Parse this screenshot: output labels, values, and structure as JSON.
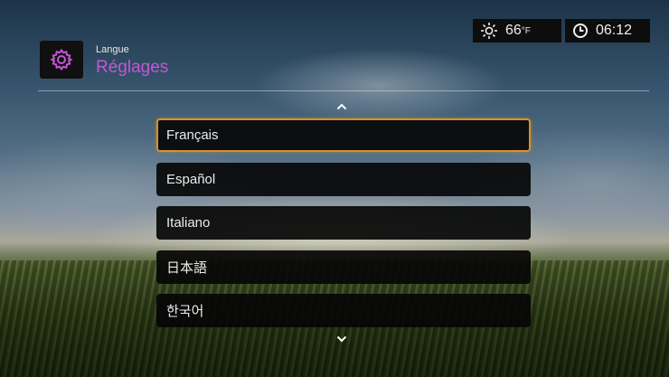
{
  "header": {
    "breadcrumb": "Langue",
    "title": "Réglages",
    "icon": "gear-icon",
    "accent_color": "#c456d6"
  },
  "status_bar": {
    "weather_icon": "sun-icon",
    "temperature": "66",
    "temperature_unit": "°F",
    "clock_icon": "clock-icon",
    "time": "06:12"
  },
  "language_list": {
    "scroll_up_icon": "chevron-up-icon",
    "scroll_down_icon": "chevron-down-icon",
    "selected_index": 0,
    "selection_color": "#d8912a",
    "items": [
      {
        "label": "Français"
      },
      {
        "label": "Español"
      },
      {
        "label": "Italiano"
      },
      {
        "label": "日本語"
      },
      {
        "label": "한국어"
      }
    ]
  }
}
